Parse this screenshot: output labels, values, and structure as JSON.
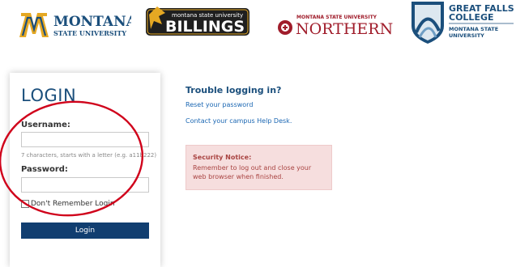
{
  "header": {
    "logos": {
      "msu": {
        "line1": "MONTANA",
        "line2": "STATE UNIVERSITY",
        "mark": "M"
      },
      "billings": {
        "line1": "montana state university",
        "line2": "BILLINGS"
      },
      "northern": {
        "line1": "MONTANA STATE UNIVERSITY",
        "line2": "NORTHERN"
      },
      "gfc": {
        "line1": "GREAT FALLS",
        "line2": "COLLEGE",
        "line3": "MONTANA STATE",
        "line4": "UNIVERSITY"
      }
    }
  },
  "login": {
    "title": "LOGIN",
    "username_label": "Username:",
    "username_value": "",
    "username_hint": "7 characters, starts with a letter (e.g. a11b222)",
    "password_label": "Password:",
    "password_value": "",
    "remember_label": "Don't Remember Login",
    "remember_checked": false,
    "button_label": "Login"
  },
  "help": {
    "title": "Trouble logging in?",
    "reset_link": "Reset your password",
    "helpdesk_link": "Contact your campus Help Desk."
  },
  "notice": {
    "title": "Security Notice:",
    "body": "Remember to log out and close your web browser when finished."
  },
  "colors": {
    "brand_blue": "#1b4f7c",
    "button_blue": "#113e70",
    "link_blue": "#1b67b3",
    "msu_gold": "#e5a823",
    "northern_red": "#a01d2b",
    "notice_bg": "#f6dede",
    "notice_text": "#a94442",
    "annotation_red": "#d0021b"
  }
}
